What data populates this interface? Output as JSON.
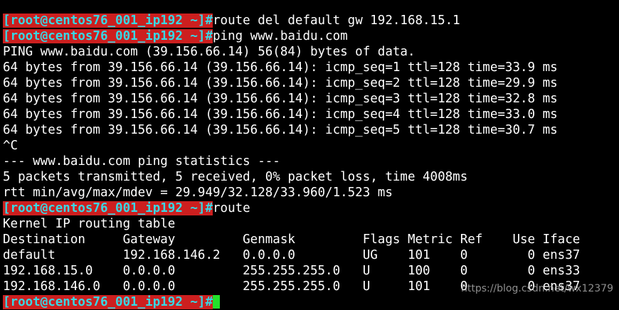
{
  "terminal": {
    "prompt": "[root@centos76_001_ip192 ~]#",
    "lines": [
      {
        "prompt": true,
        "text": "route del default gw 192.168.15.1"
      },
      {
        "prompt": true,
        "text": "ping www.baidu.com"
      },
      {
        "prompt": false,
        "text": "PING www.baidu.com (39.156.66.14) 56(84) bytes of data."
      },
      {
        "prompt": false,
        "text": "64 bytes from 39.156.66.14 (39.156.66.14): icmp_seq=1 ttl=128 time=33.9 ms"
      },
      {
        "prompt": false,
        "text": "64 bytes from 39.156.66.14 (39.156.66.14): icmp_seq=2 ttl=128 time=29.9 ms"
      },
      {
        "prompt": false,
        "text": "64 bytes from 39.156.66.14 (39.156.66.14): icmp_seq=3 ttl=128 time=32.8 ms"
      },
      {
        "prompt": false,
        "text": "64 bytes from 39.156.66.14 (39.156.66.14): icmp_seq=4 ttl=128 time=33.0 ms"
      },
      {
        "prompt": false,
        "text": "64 bytes from 39.156.66.14 (39.156.66.14): icmp_seq=5 ttl=128 time=30.7 ms"
      },
      {
        "prompt": false,
        "text": "^C"
      },
      {
        "prompt": false,
        "text": "--- www.baidu.com ping statistics ---"
      },
      {
        "prompt": false,
        "text": "5 packets transmitted, 5 received, 0% packet loss, time 4008ms"
      },
      {
        "prompt": false,
        "text": "rtt min/avg/max/mdev = 29.949/32.128/33.960/1.523 ms"
      },
      {
        "prompt": true,
        "text": "route"
      },
      {
        "prompt": false,
        "text": "Kernel IP routing table"
      },
      {
        "prompt": false,
        "text": "Destination     Gateway         Genmask         Flags Metric Ref    Use Iface"
      },
      {
        "prompt": false,
        "text": "default         192.168.146.2   0.0.0.0         UG    101    0        0 ens37"
      },
      {
        "prompt": false,
        "text": "192.168.15.0    0.0.0.0         255.255.255.0   U     100    0        0 ens33"
      },
      {
        "prompt": false,
        "text": "192.168.146.0   0.0.0.0         255.255.255.0   U     101    0        0 ens37"
      },
      {
        "prompt": true,
        "text": "",
        "cursor": true
      }
    ]
  },
  "colors": {
    "background": "#000000",
    "foreground": "#ffffff",
    "prompt_bg": "#cc1f1f",
    "prompt_fg": "#37d8e5",
    "cursor": "#22e22a"
  },
  "watermark": "https://blog.csdn.net/wx12379"
}
